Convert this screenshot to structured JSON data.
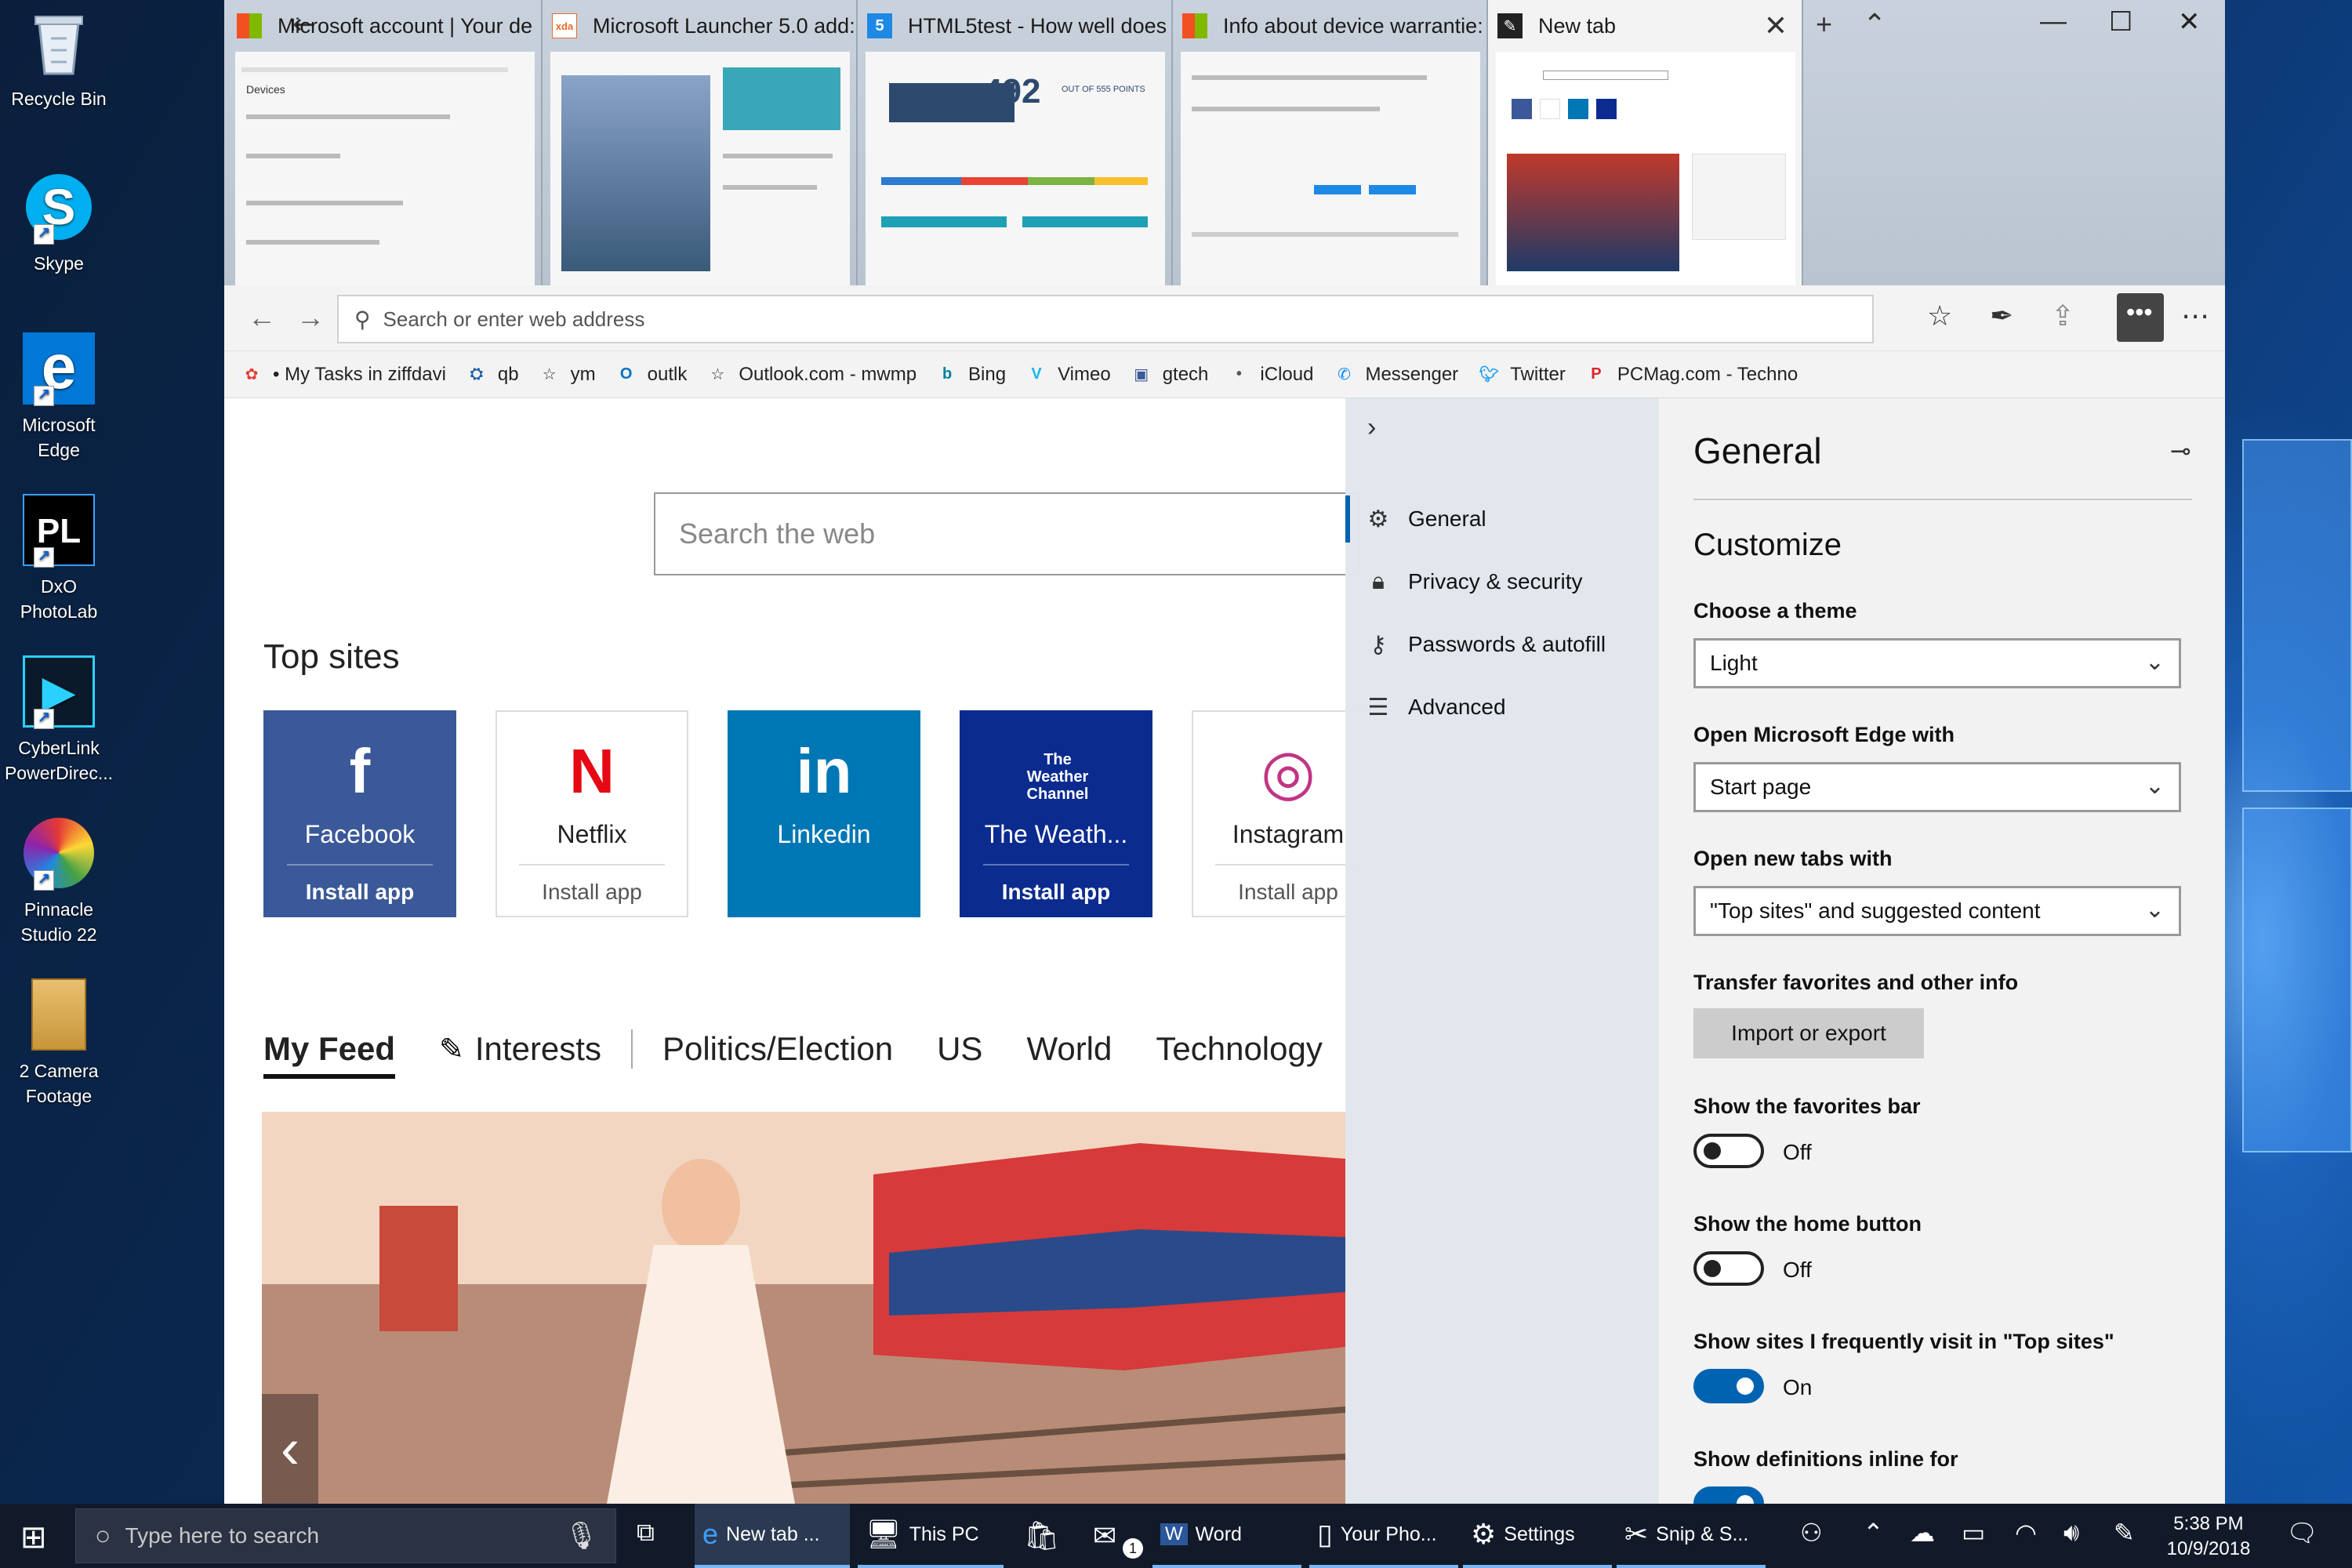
{
  "desktop": {
    "icons": [
      {
        "label": "Recycle Bin",
        "icon": "recycle-bin-icon"
      },
      {
        "label": "Skype",
        "icon": "skype-icon"
      },
      {
        "label": "Microsoft Edge",
        "icon": "edge-icon"
      },
      {
        "label": "DxO PhotoLab",
        "icon": "dxo-icon"
      },
      {
        "label": "CyberLink PowerDirec...",
        "icon": "cyberlink-icon"
      },
      {
        "label": "Pinnacle Studio 22",
        "icon": "pinnacle-icon"
      },
      {
        "label": "2 Camera Footage",
        "icon": "folder-icon"
      }
    ]
  },
  "browser": {
    "tabs": [
      {
        "title": "Microsoft account | Your de",
        "favicon_color": "#f25022"
      },
      {
        "title": "Microsoft Launcher 5.0 add:",
        "favicon_color": "#e86a2a"
      },
      {
        "title": "HTML5test - How well does",
        "favicon_color": "#1e88e5"
      },
      {
        "title": "Info about device warrantie:",
        "favicon_color": "#7fba00"
      },
      {
        "title": "New tab",
        "favicon_color": "#222222"
      }
    ],
    "preview_score": "492",
    "preview_score_label": "OUT OF 555 POINTS",
    "address_placeholder": "Search or enter web address",
    "favorites": [
      {
        "label": "• My Tasks in ziffdavi",
        "color": "#e0403a"
      },
      {
        "label": "qb",
        "color": "#1e5fa8"
      },
      {
        "label": "ym",
        "color": "#333333"
      },
      {
        "label": "outlk",
        "color": "#0072c6"
      },
      {
        "label": "Outlook.com - mwmp",
        "color": "#333333"
      },
      {
        "label": "Bing",
        "color": "#00809d"
      },
      {
        "label": "Vimeo",
        "color": "#1ab7ea"
      },
      {
        "label": "gtech",
        "color": "#3b5998"
      },
      {
        "label": "iCloud",
        "color": "#555555"
      },
      {
        "label": "Messenger",
        "color": "#0084ff"
      },
      {
        "label": "Twitter",
        "color": "#1da1f2"
      },
      {
        "label": "PCMag.com - Techno",
        "color": "#d9262c"
      }
    ]
  },
  "page": {
    "search_placeholder": "Search the web",
    "top_sites_title": "Top sites",
    "top_sites": [
      {
        "name": "Facebook",
        "logo": "f",
        "install": "Install app",
        "bg": "#3b5998",
        "fg": "#ffffff"
      },
      {
        "name": "Netflix",
        "logo": "N",
        "install": "Install app",
        "bg": "#ffffff",
        "fg": "#222222"
      },
      {
        "name": "Linkedin",
        "logo": "in",
        "install": "",
        "bg": "#0077b5",
        "fg": "#ffffff"
      },
      {
        "name": "The Weath...",
        "logo": "The Weather Channel",
        "install": "Install app",
        "bg": "#0b2b8f",
        "fg": "#ffffff"
      },
      {
        "name": "Instagram",
        "logo": "◎",
        "install": "Install app",
        "bg": "#ffffff",
        "fg": "#222222"
      }
    ],
    "feed_tabs": [
      "My Feed",
      "Interests",
      "Politics/Election",
      "US",
      "World",
      "Technology"
    ]
  },
  "settings": {
    "nav": [
      {
        "label": "General",
        "icon": "gear-icon"
      },
      {
        "label": "Privacy & security",
        "icon": "lock-icon"
      },
      {
        "label": "Passwords & autofill",
        "icon": "key-icon"
      },
      {
        "label": "Advanced",
        "icon": "sliders-icon"
      }
    ],
    "title": "General",
    "section": "Customize",
    "theme_label": "Choose a theme",
    "theme_value": "Light",
    "open_with_label": "Open Microsoft Edge with",
    "open_with_value": "Start page",
    "new_tabs_label": "Open new tabs with",
    "new_tabs_value": "\"Top sites\" and suggested content",
    "transfer_label": "Transfer favorites and other info",
    "transfer_button": "Import or export",
    "favbar_label": "Show the favorites bar",
    "favbar_state": "Off",
    "home_label": "Show the home button",
    "home_state": "Off",
    "frequent_label": "Show sites I frequently visit in \"Top sites\"",
    "frequent_state": "On",
    "definitions_label": "Show definitions inline for",
    "accent_color": "#0063b1"
  },
  "taskbar": {
    "search_placeholder": "Type here to search",
    "apps": [
      {
        "label": "New tab ...",
        "icon": "edge-icon"
      },
      {
        "label": "This PC",
        "icon": "this-pc-icon"
      },
      {
        "label": "",
        "icon": "store-icon"
      },
      {
        "label": "",
        "icon": "mail-icon"
      },
      {
        "label": "Word",
        "icon": "word-icon"
      },
      {
        "label": "Your Pho...",
        "icon": "phone-icon"
      },
      {
        "label": "Settings",
        "icon": "gear-icon"
      },
      {
        "label": "Snip & S...",
        "icon": "snip-icon"
      }
    ],
    "mail_badge": "1",
    "time": "5:38 PM",
    "date": "10/9/2018"
  }
}
